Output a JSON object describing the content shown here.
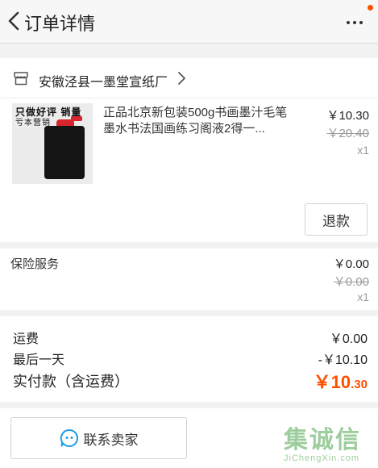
{
  "header": {
    "title": "订单详情"
  },
  "shop": {
    "name": "安徽泾县一墨堂宣纸厂"
  },
  "item": {
    "thumb_banner_line1": "只做好评 销量",
    "thumb_banner_line2": "亏本营销",
    "title": "正品北京新包装500g书画墨汁毛笔墨水书法国画练习阁液2得一...",
    "price": "￥10.30",
    "original_price": "￥20.40",
    "quantity": "x1",
    "refund_label": "退款"
  },
  "insurance": {
    "label": "保险服务",
    "price": "￥0.00",
    "original_price": "￥0.00",
    "quantity": "x1"
  },
  "summary": {
    "shipping_label": "运费",
    "shipping_value": "￥0.00",
    "discount_label": "最后一天",
    "discount_value": "-￥10.10",
    "total_label": "实付款（含运费）",
    "total_currency_int": "￥10",
    "total_decimal": ".30"
  },
  "footer": {
    "contact_label": "联系卖家"
  },
  "watermark": {
    "text_cn": "集诚信",
    "text_en": "JiChengXin.com"
  },
  "colors": {
    "accent": "#ff5000",
    "background": "#f2f2f2"
  }
}
